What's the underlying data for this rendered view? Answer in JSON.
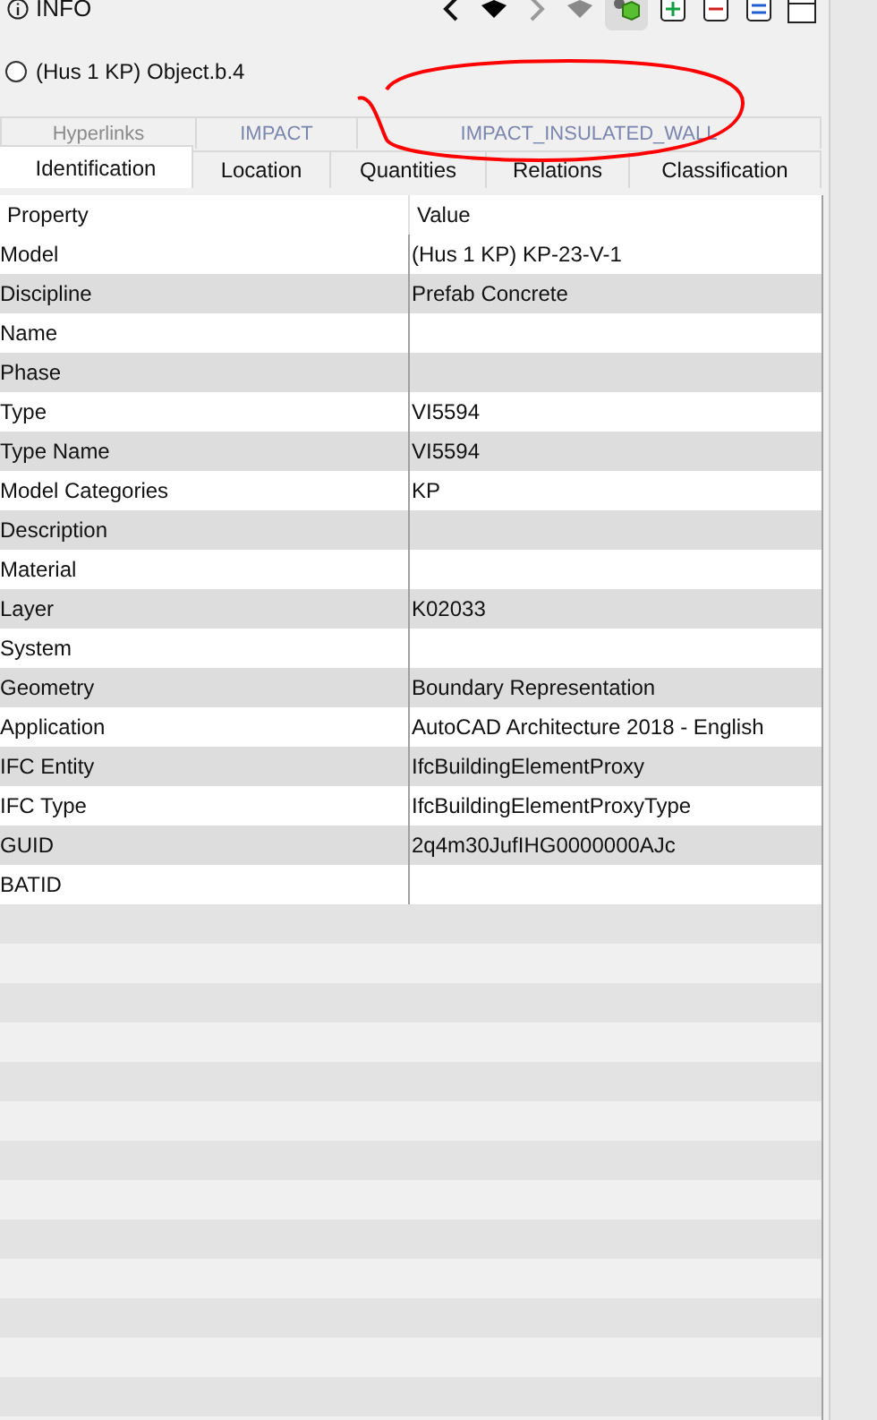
{
  "panel": {
    "title": "INFO"
  },
  "toolbar": [
    {
      "kind": "back",
      "disabled": false
    },
    {
      "kind": "history",
      "disabled": false
    },
    {
      "kind": "forward",
      "disabled": true
    },
    {
      "kind": "history",
      "disabled": true
    },
    {
      "kind": "model",
      "selected": true
    },
    {
      "kind": "add",
      "selected": false
    },
    {
      "kind": "remove",
      "selected": false
    },
    {
      "kind": "list",
      "selected": false
    },
    {
      "kind": "window",
      "selected": false
    }
  ],
  "object": {
    "label": "(Hus 1 KP) Object.b.4",
    "selected": false
  },
  "tabs_upper": [
    {
      "label": "Hyperlinks",
      "selected": false
    },
    {
      "label": "IMPACT",
      "selected": false
    },
    {
      "label": "IMPACT_INSULATED_WALL",
      "selected": false
    }
  ],
  "tabs_lower": [
    {
      "label": "Identification",
      "selected": true
    },
    {
      "label": "Location",
      "selected": false
    },
    {
      "label": "Quantities",
      "selected": false
    },
    {
      "label": "Relations",
      "selected": false
    },
    {
      "label": "Classification",
      "selected": false
    }
  ],
  "table": {
    "columns": [
      "Property",
      "Value"
    ],
    "rows": [
      {
        "property": "Model",
        "value": "(Hus 1 KP) KP-23-V-1"
      },
      {
        "property": "Discipline",
        "value": "Prefab Concrete"
      },
      {
        "property": "Name"
      },
      {
        "property": "Phase"
      },
      {
        "property": "Type",
        "value": "VI5594"
      },
      {
        "property": "Type Name",
        "value": "VI5594"
      },
      {
        "property": "Model Categories",
        "value": "KP"
      },
      {
        "property": "Description"
      },
      {
        "property": "Material"
      },
      {
        "property": "Layer",
        "value": "K02033"
      },
      {
        "property": "System"
      },
      {
        "property": "Geometry",
        "value": "Boundary Representation"
      },
      {
        "property": "Application",
        "value": "AutoCAD Architecture 2018 - English"
      },
      {
        "property": "IFC Entity",
        "value": "IfcBuildingElementProxy"
      },
      {
        "property": "IFC Type",
        "value": "IfcBuildingElementProxyType"
      },
      {
        "property": "GUID",
        "value": "2q4m30JufIHG0000000AJc"
      },
      {
        "property": "BATID"
      }
    ]
  },
  "annotation": {
    "kind": "circle",
    "color": "#ff0000"
  }
}
